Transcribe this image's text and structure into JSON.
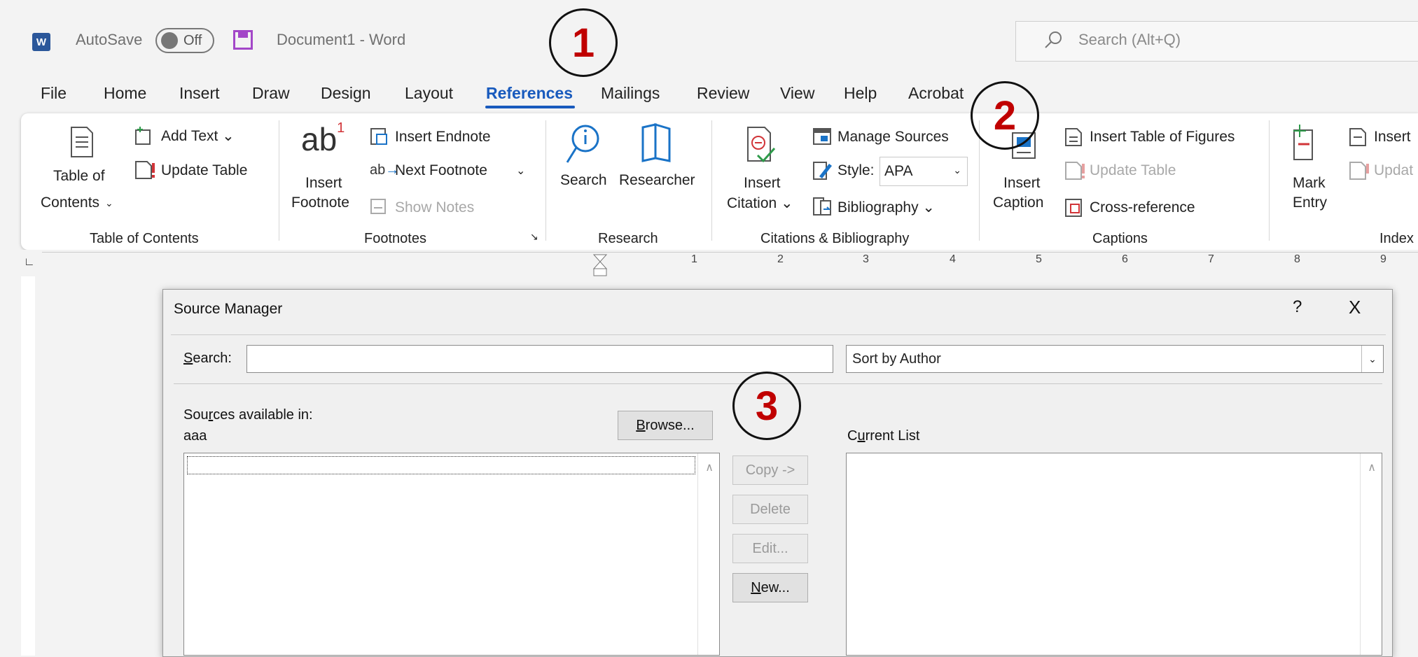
{
  "titlebar": {
    "app_icon": "W",
    "autosave_label": "AutoSave",
    "autosave_state": "Off",
    "document_title": "Document1  -  Word",
    "search_placeholder": "Search (Alt+Q)"
  },
  "tabs": [
    "File",
    "Home",
    "Insert",
    "Draw",
    "Design",
    "Layout",
    "References",
    "Mailings",
    "Review",
    "View",
    "Help",
    "Acrobat"
  ],
  "active_tab": "References",
  "callouts": [
    "1",
    "2",
    "3"
  ],
  "ribbon": {
    "toc": {
      "add_text": "Add Text",
      "update_table": "Update Table",
      "table_of": "Table of",
      "contents": "Contents",
      "group": "Table of Contents"
    },
    "footnotes": {
      "ab": "ab",
      "sup": "1",
      "insert": "Insert",
      "footnote": "Footnote",
      "insert_endnote": "Insert Endnote",
      "next_footnote": "Next Footnote",
      "show_notes": "Show Notes",
      "group": "Footnotes"
    },
    "research": {
      "search": "Search",
      "researcher": "Researcher",
      "group": "Research"
    },
    "citations": {
      "insert": "Insert",
      "citation": "Citation",
      "manage_sources": "Manage Sources",
      "style_label": "Style:",
      "style_value": "APA",
      "bibliography": "Bibliography",
      "group": "Citations & Bibliography"
    },
    "captions": {
      "insert": "Insert",
      "caption": "Caption",
      "insert_table_of_figures": "Insert Table of Figures",
      "update_table": "Update Table",
      "cross_reference": "Cross-reference",
      "group": "Captions"
    },
    "index": {
      "mark": "Mark",
      "entry": "Entry",
      "insert": "Insert",
      "update": "Updat",
      "group": "Index"
    }
  },
  "ruler": [
    "1",
    "2",
    "3",
    "4",
    "5",
    "6",
    "7",
    "8",
    "9"
  ],
  "dialog": {
    "title": "Source Manager",
    "help": "?",
    "close": "X",
    "search_label_u": "S",
    "search_label_rest": "earch:",
    "sort_value": "Sort by Author",
    "sources_label_a": "Sou",
    "sources_label_u": "r",
    "sources_label_b": "ces available in:",
    "sources_location": "aaa",
    "browse_u": "B",
    "browse_rest": "rowse...",
    "current_a": "C",
    "current_u": "u",
    "current_b": "rrent List",
    "copy": "Copy ->",
    "delete": "Delete",
    "edit": "Edit...",
    "new_u": "N",
    "new_rest": "ew..."
  }
}
